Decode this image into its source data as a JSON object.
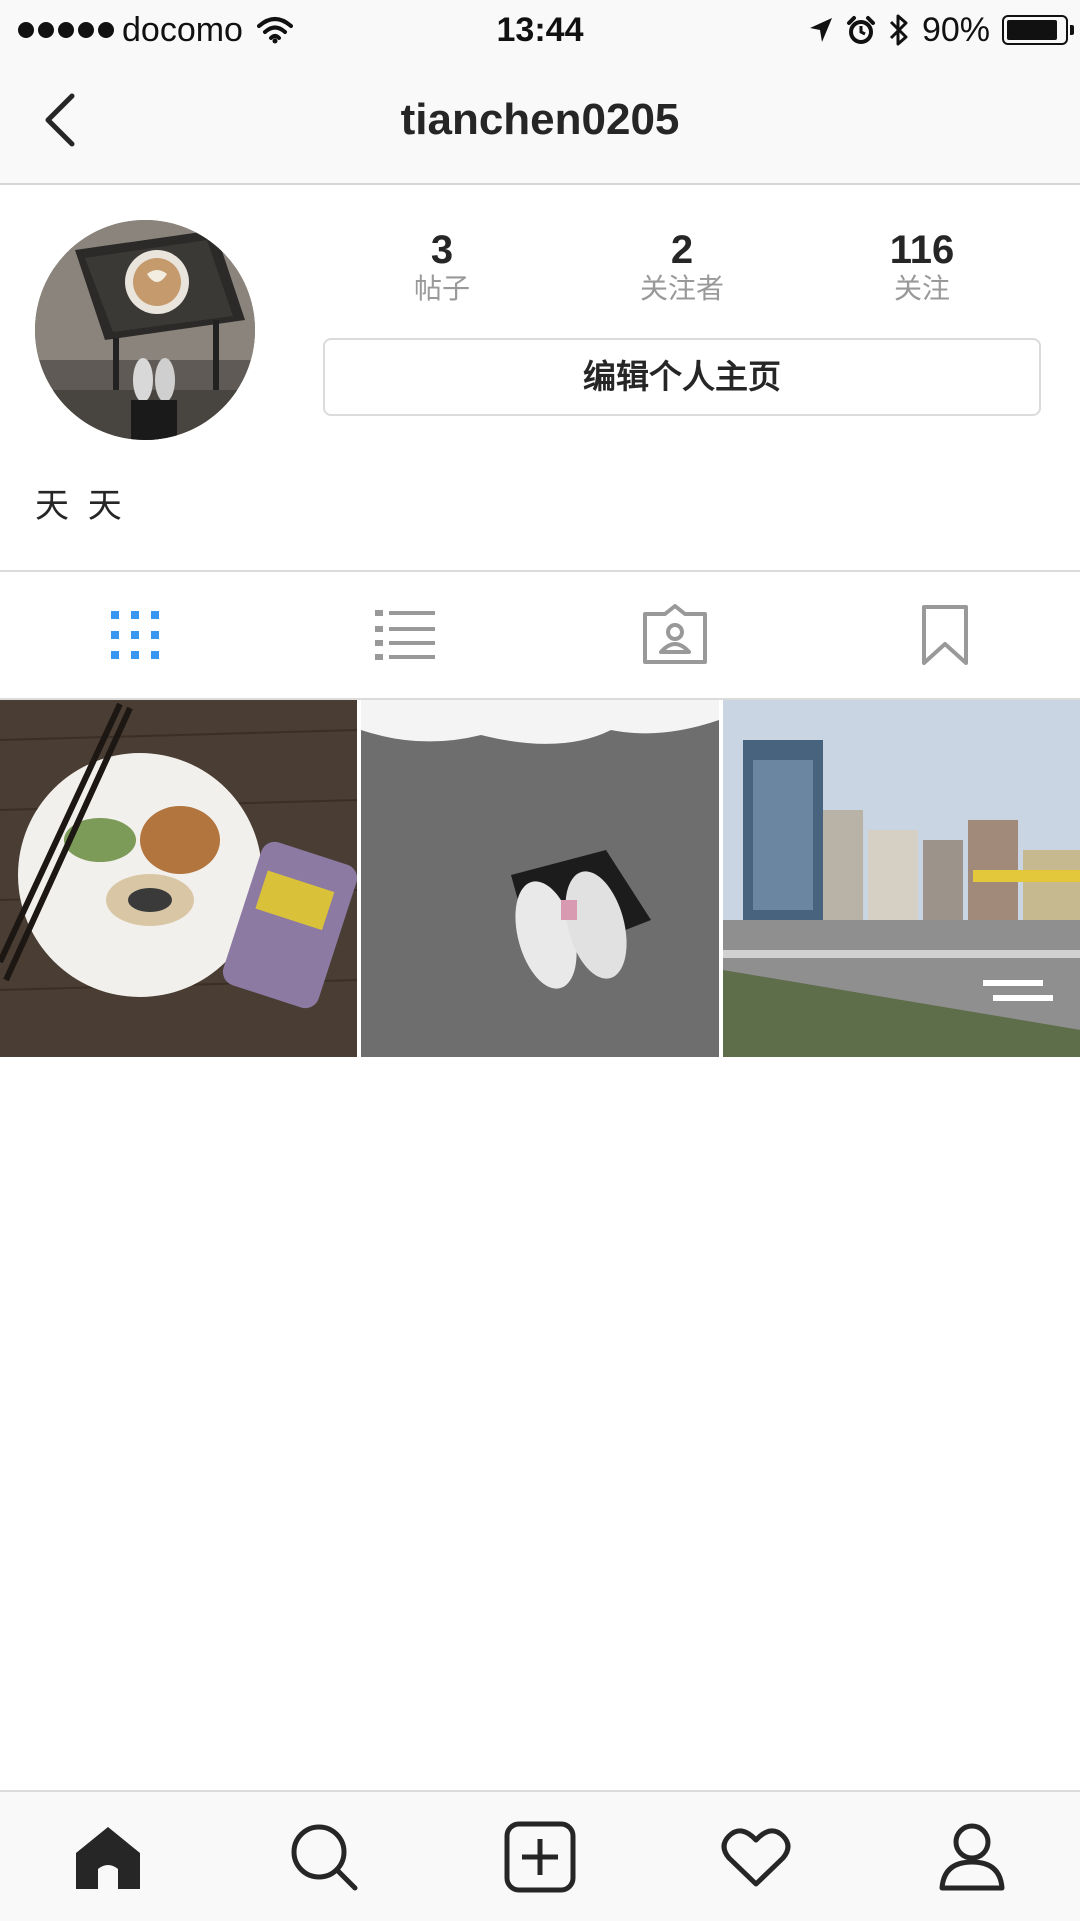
{
  "status_bar": {
    "carrier": "docomo",
    "time": "13:44",
    "battery_percent": "90%",
    "battery_level": 0.9,
    "icons": [
      "signal-dots",
      "wifi-icon",
      "location-arrow-icon",
      "alarm-icon",
      "bluetooth-icon",
      "battery-icon"
    ]
  },
  "nav": {
    "title": "tianchen0205",
    "back_icon": "chevron-left-icon"
  },
  "profile": {
    "stats": [
      {
        "count": "3",
        "label": "帖子"
      },
      {
        "count": "2",
        "label": "关注者"
      },
      {
        "count": "116",
        "label": "关注"
      }
    ],
    "edit_button_label": "编辑个人主页",
    "full_name": "天 天"
  },
  "tabs": [
    {
      "icon": "grid-icon",
      "active": true
    },
    {
      "icon": "list-icon",
      "active": false
    },
    {
      "icon": "tagged-icon",
      "active": false
    },
    {
      "icon": "bookmark-icon",
      "active": false
    }
  ],
  "posts": [
    {
      "subject": "food-plate-with-can"
    },
    {
      "subject": "white-sneakers-on-carpet"
    },
    {
      "subject": "city-street-view"
    }
  ],
  "bottom_nav": [
    {
      "icon": "home-icon",
      "active": true
    },
    {
      "icon": "search-icon",
      "active": false
    },
    {
      "icon": "add-post-icon",
      "active": false
    },
    {
      "icon": "heart-icon",
      "active": false
    },
    {
      "icon": "profile-icon",
      "active": false
    }
  ],
  "colors": {
    "active_tab": "#3897f0",
    "inactive_icon": "#999999",
    "text": "#262626",
    "bar_background": "#f9f9f9"
  }
}
